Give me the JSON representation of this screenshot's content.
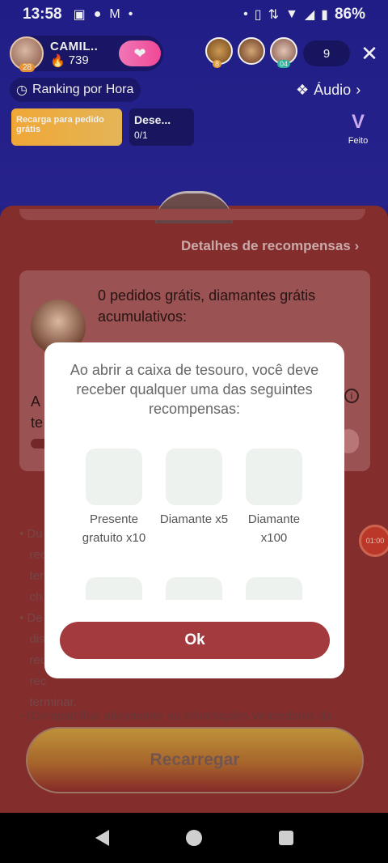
{
  "status_bar": {
    "time": "13:58",
    "battery_percent": "86%",
    "left_icons": [
      "photo-icon",
      "circle-icon",
      "gmail-icon",
      "dot-icon"
    ],
    "right_icons": [
      "dot-icon",
      "vibrate-icon",
      "data-icon",
      "wifi-icon",
      "signal-icon",
      "battery-icon"
    ]
  },
  "header": {
    "host_name": "CAMIL..",
    "host_level": "28",
    "host_score": "739",
    "viewers": [
      {
        "badge": "8",
        "badge_color": "#f0a53a"
      },
      {
        "badge": "",
        "badge_color": "#b86b3c"
      },
      {
        "badge": "04",
        "badge_color": "#2fc0a8"
      }
    ],
    "viewer_count": "9",
    "ranking_label": "Ranking por Hora",
    "audio_label": "Áudio",
    "promo_text": "Recarga para pedido grátis",
    "task_title": "Dese...",
    "task_progress": "0/1",
    "done_label": "Feito"
  },
  "sheet": {
    "details_link": "Detalhes de recompensas",
    "card_title": "0 pedidos grátis, diamantes grátis acumulativos:",
    "card_line1": "A",
    "card_line2": "te",
    "info_symbol": "i",
    "bullets": [
      "Du",
      "rec",
      "ter",
      "ch",
      "De",
      "dis",
      "rec",
      "rec",
      "terminar."
    ],
    "bullet_last": "(Compartilhar ativamente as informações vencedoras da",
    "recharge_label": "Recarregar",
    "timer_label": "01:00"
  },
  "modal": {
    "text": "Ao abrir a caixa de tesouro, você deve receber qualquer uma das seguintes recompensas:",
    "rewards": [
      {
        "label": "Presente gratuito x10"
      },
      {
        "label": "Diamante x5"
      },
      {
        "label": "Diamante x100"
      }
    ],
    "ok_label": "Ok"
  },
  "navbar": {
    "icons": [
      "back-icon",
      "home-icon",
      "recents-icon"
    ]
  }
}
